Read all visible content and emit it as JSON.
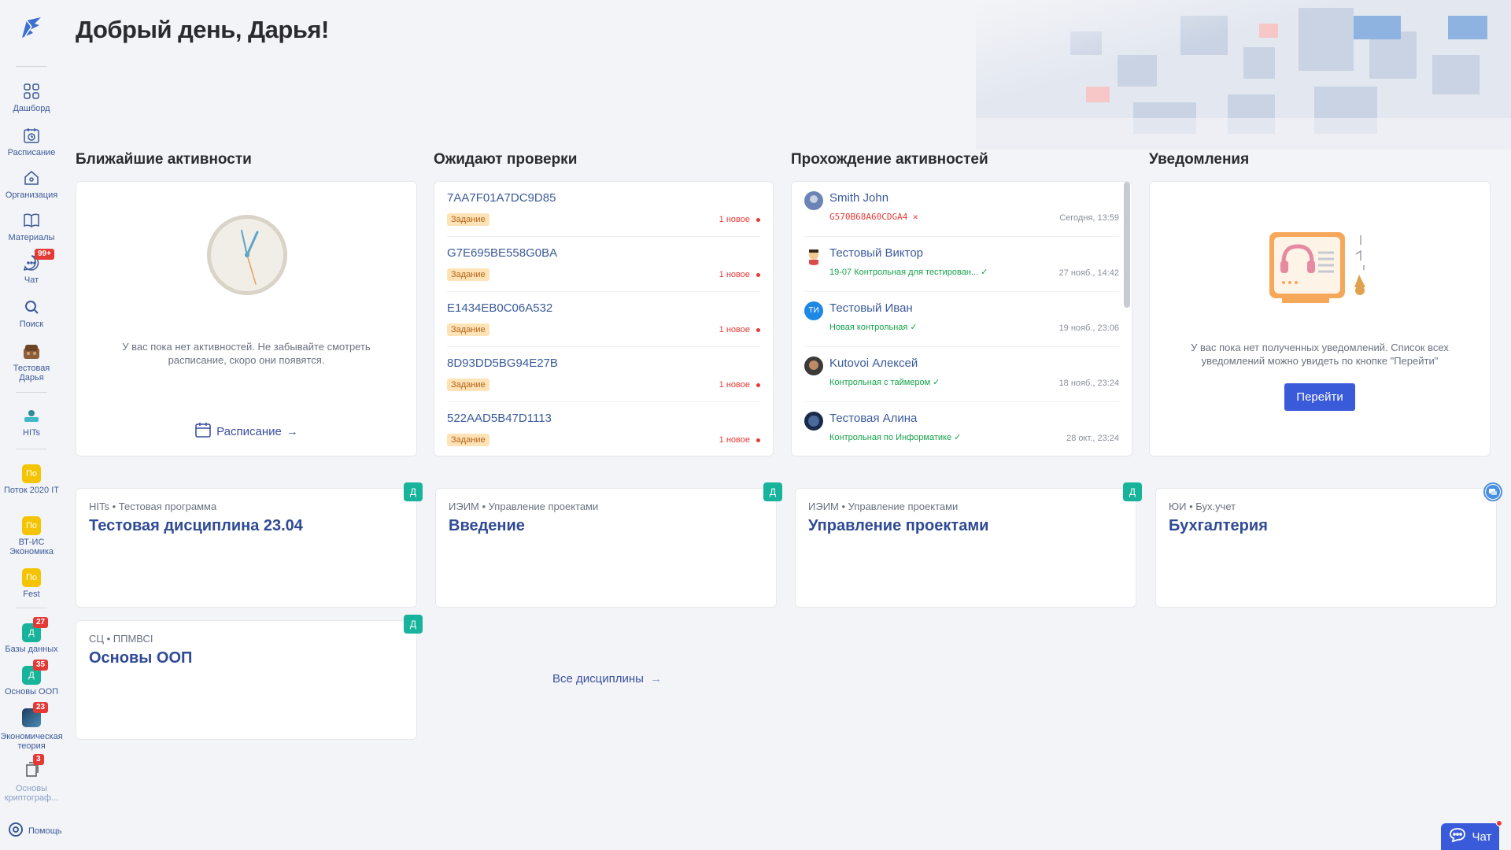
{
  "greeting": "Добрый день, Дарья!",
  "sidebar": {
    "items": [
      {
        "label": "Дашборд"
      },
      {
        "label": "Расписание"
      },
      {
        "label": "Организация"
      },
      {
        "label": "Материалы"
      },
      {
        "label": "Чат",
        "badge": "99+"
      },
      {
        "label": "Поиск"
      },
      {
        "label": "Тестовая Дарья"
      }
    ],
    "org": {
      "label": "HITs"
    },
    "groups": [
      {
        "icon": "По",
        "label": "Поток 2020 IT"
      },
      {
        "icon": "По",
        "label": "ВТ-ИС Экономика"
      },
      {
        "icon": "По",
        "label": "Fest"
      }
    ],
    "courses": [
      {
        "icon": "Д",
        "label": "Базы данных",
        "badge": "27"
      },
      {
        "icon": "Д",
        "label": "Основы ООП",
        "badge": "35"
      },
      {
        "icon": "",
        "label": "Экономическая теория",
        "badge": "23"
      },
      {
        "icon": "",
        "label": "Основы криптограф...",
        "badge": "3"
      }
    ],
    "help": "Помощь"
  },
  "sections": {
    "activities": "Ближайшие активности",
    "review": "Ожидают проверки",
    "progress": "Прохождение активностей",
    "notifications": "Уведомления"
  },
  "activities": {
    "empty_line1": "У вас пока нет активностей. Не забывайте смотреть",
    "empty_line2": "расписание, скоро они появятся.",
    "link": "Расписание"
  },
  "review": [
    {
      "code": "7AA7F01A7DC9D85",
      "tag": "Задание",
      "status": "1 новое"
    },
    {
      "code": "G7E695BE558G0BA",
      "tag": "Задание",
      "status": "1 новое"
    },
    {
      "code": "E1434EB0C06A532",
      "tag": "Задание",
      "status": "1 новое"
    },
    {
      "code": "8D93DD5BG94E27B",
      "tag": "Задание",
      "status": "1 новое"
    },
    {
      "code": "522AAD5B47D1113",
      "tag": "Задание",
      "status": "1 новое"
    }
  ],
  "progress": [
    {
      "name": "Smith John",
      "status": "G570B68A60CDGA4 ✕",
      "time": "Сегодня, 13:59",
      "state": "err"
    },
    {
      "name": "Тестовый Виктор",
      "status": "19-07 Контрольная для тестирован... ✓",
      "time": "27 нояб., 14:42",
      "state": "ok"
    },
    {
      "name": "Тестовый Иван",
      "status": "Новая контрольная ✓",
      "time": "19 нояб., 23:06",
      "state": "ok",
      "initials": "ТИ"
    },
    {
      "name": "Kutovoi Алексей",
      "status": "Контрольная с таймером ✓",
      "time": "18 нояб., 23:24",
      "state": "ok"
    },
    {
      "name": "Тестовая Алина",
      "status": "Контрольная по Информатике ✓",
      "time": "28 окт., 23:24",
      "state": "ok"
    }
  ],
  "notifications": {
    "empty_line1": "У вас пока нет полученных уведомлений. Список всех",
    "empty_line2": "уведомлений можно увидеть по кнопке \"Перейти\"",
    "button": "Перейти"
  },
  "disciplines": [
    {
      "crumb": "HITs • Тестовая программа",
      "title": "Тестовая дисциплина 23.04",
      "tag": "Д"
    },
    {
      "crumb": "ИЭИМ • Управление проектами",
      "title": "Введение",
      "tag": "Д"
    },
    {
      "crumb": "ИЭИМ • Управление проектами",
      "title": "Управление проектами",
      "tag": "Д"
    },
    {
      "crumb": "ЮИ • Бух.учет",
      "title": "Бухгалтерия",
      "tag": ""
    },
    {
      "crumb": "СЦ • ППМВСI",
      "title": "Основы ООП",
      "tag": "Д"
    }
  ],
  "all_disciplines": "Все дисциплины",
  "chat_button": "Чат"
}
